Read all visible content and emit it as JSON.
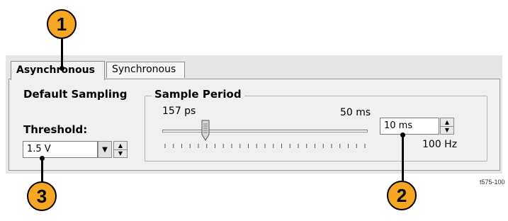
{
  "tabs": [
    {
      "label": "Asynchronous",
      "active": true
    },
    {
      "label": "Synchronous",
      "active": false
    }
  ],
  "panel": {
    "default_sampling_label": "Default Sampling",
    "threshold_label": "Threshold:",
    "threshold_value": "1.5 V"
  },
  "sample_period": {
    "title": "Sample Period",
    "min_label": "157 ps",
    "max_label": "50 ms",
    "value": "10 ms",
    "frequency": "100 Hz",
    "slider_position_fraction": 0.21
  },
  "callouts": [
    "1",
    "2",
    "3"
  ],
  "figure_code": "t575-100",
  "colors": {
    "callout_fill": "#f5a623",
    "panel_bg": "#f0f0f0",
    "dialog_bg": "#e6e6e6"
  }
}
